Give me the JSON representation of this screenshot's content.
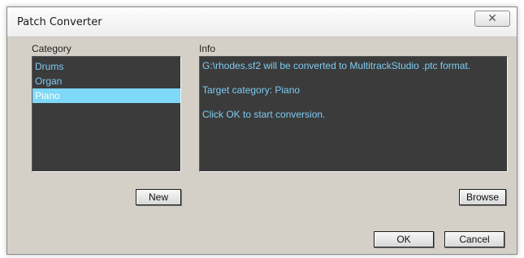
{
  "window": {
    "title": "Patch Converter",
    "close_symbol": "✕"
  },
  "category": {
    "label": "Category",
    "items": [
      "Drums",
      "Organ",
      "Piano"
    ],
    "selected": "Piano",
    "new_button": "New"
  },
  "info": {
    "label": "Info",
    "lines": [
      "G:\\rhodes.sf2 will be converted to MultitrackStudio .ptc format.",
      "Target category: Piano",
      "Click OK to start conversion."
    ],
    "browse_button": "Browse"
  },
  "footer": {
    "ok_button": "OK",
    "cancel_button": "Cancel"
  },
  "colors": {
    "panel_bg": "#3b3b3b",
    "text_accent": "#7ecbf2",
    "selection": "#7fd8f7"
  }
}
